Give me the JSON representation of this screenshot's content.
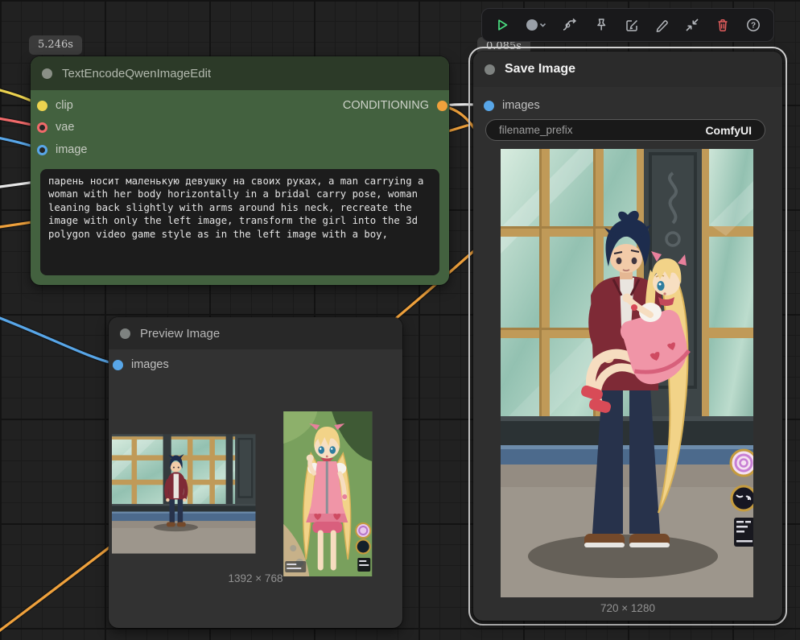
{
  "toolbar": {
    "icons": [
      "run-icon",
      "queue-mode-icon",
      "spline-icon",
      "pin-icon",
      "edit-box-icon",
      "pencil-icon",
      "collapse-icon",
      "trash-icon",
      "help-icon"
    ]
  },
  "nodes": {
    "textencode": {
      "badge": "5.246s",
      "title": "TextEncodeQwenImageEdit",
      "inputs": [
        {
          "name": "clip",
          "color": "#edd34f"
        },
        {
          "name": "vae",
          "color": "#f16a6a"
        },
        {
          "name": "image",
          "color": "#58a6e8"
        }
      ],
      "output": "CONDITIONING",
      "prompt": "парень носит маленькую девушку на своих руках, a man carrying a woman with her body horizontally in a bridal carry pose, woman leaning back slightly with arms around his neck, recreate the image with only the left image, transform the girl into the 3d polygon video game style as in the left image with a boy,"
    },
    "preview": {
      "title": "Preview Image",
      "input": "images",
      "caption": "1392 × 768"
    },
    "save": {
      "badge": "0.085s",
      "title": "Save Image",
      "input": "images",
      "widget": {
        "label": "filename_prefix",
        "value": "ComfyUI"
      },
      "caption": "720 × 1280"
    }
  },
  "colors": {
    "clip": "#edd34f",
    "vae": "#f16a6a",
    "image": "#58a6e8",
    "conditioning": "#efa13c",
    "wire_white": "#e8e8e8",
    "node_green_header": "#2c3a28",
    "node_green_body": "#43613f",
    "selection_outline": "#d9d9d9",
    "run_green": "#4ade80",
    "trash_red": "#e25d5d"
  }
}
